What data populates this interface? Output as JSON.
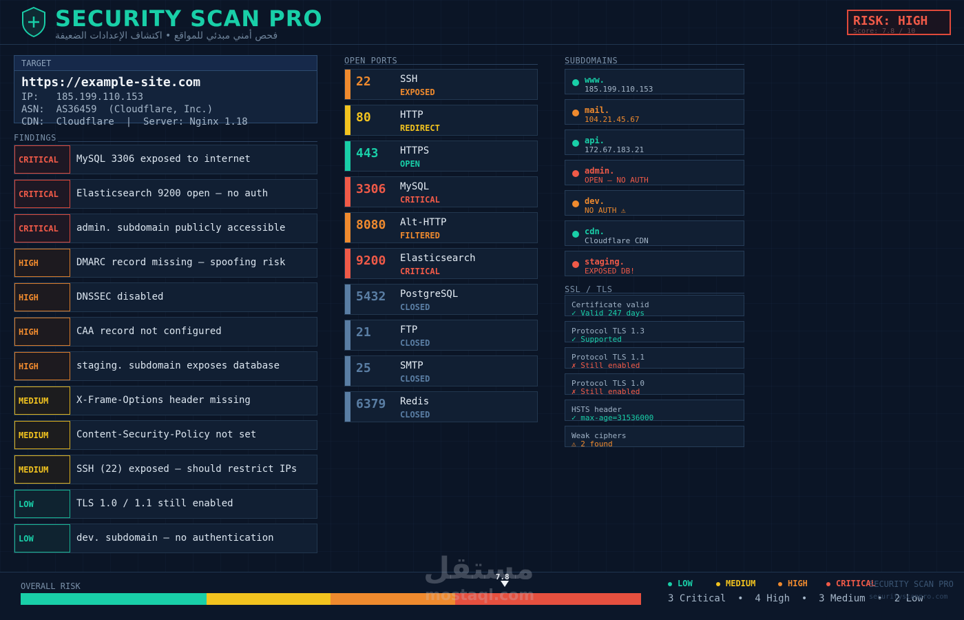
{
  "header": {
    "title": "SECURITY SCAN PRO",
    "subtitle": "فحص أمني مبدئي للمواقع  •  اكتشاف الإعدادات الضعيفة",
    "risk_label": "RISK: HIGH",
    "risk_score": "Score: 7.8 / 10"
  },
  "target": {
    "label": "TARGET",
    "url": "https://example-site.com",
    "ip": "IP:   185.199.110.153",
    "asn": "ASN:  AS36459  (Cloudflare, Inc.)",
    "cdn": "CDN:  Cloudflare  |  Server: Nginx 1.18"
  },
  "findings": {
    "label": "FINDINGS",
    "items": [
      {
        "severity": "CRITICAL",
        "level": "critical",
        "text": "MySQL 3306 exposed to internet"
      },
      {
        "severity": "CRITICAL",
        "level": "critical",
        "text": "Elasticsearch 9200 open — no auth"
      },
      {
        "severity": "CRITICAL",
        "level": "critical",
        "text": "admin. subdomain publicly accessible"
      },
      {
        "severity": "HIGH",
        "level": "high",
        "text": "DMARC record missing — spoofing risk"
      },
      {
        "severity": "HIGH",
        "level": "high",
        "text": "DNSSEC disabled"
      },
      {
        "severity": "HIGH",
        "level": "high",
        "text": "CAA record not configured"
      },
      {
        "severity": "HIGH",
        "level": "high",
        "text": "staging. subdomain exposes database"
      },
      {
        "severity": "MEDIUM",
        "level": "medium",
        "text": "X-Frame-Options header missing"
      },
      {
        "severity": "MEDIUM",
        "level": "medium",
        "text": "Content-Security-Policy not set"
      },
      {
        "severity": "MEDIUM",
        "level": "medium",
        "text": "SSH (22) exposed — should restrict IPs"
      },
      {
        "severity": "LOW",
        "level": "low",
        "text": "TLS 1.0 / 1.1 still enabled"
      },
      {
        "severity": "LOW",
        "level": "low",
        "text": "dev. subdomain — no authentication"
      }
    ]
  },
  "ports": {
    "label": "OPEN PORTS",
    "items": [
      {
        "port": "22",
        "service": "SSH",
        "status": "EXPOSED",
        "color": "#ef8a2e"
      },
      {
        "port": "80",
        "service": "HTTP",
        "status": "REDIRECT",
        "color": "#f2c31f"
      },
      {
        "port": "443",
        "service": "HTTPS",
        "status": "OPEN",
        "color": "#19cfa8"
      },
      {
        "port": "3306",
        "service": "MySQL",
        "status": "CRITICAL",
        "color": "#f05a48"
      },
      {
        "port": "8080",
        "service": "Alt-HTTP",
        "status": "FILTERED",
        "color": "#ef8a2e"
      },
      {
        "port": "9200",
        "service": "Elasticsearch",
        "status": "CRITICAL",
        "color": "#f05a48"
      },
      {
        "port": "5432",
        "service": "PostgreSQL",
        "status": "CLOSED",
        "color": "#5a7ea4"
      },
      {
        "port": "21",
        "service": "FTP",
        "status": "CLOSED",
        "color": "#5a7ea4"
      },
      {
        "port": "25",
        "service": "SMTP",
        "status": "CLOSED",
        "color": "#5a7ea4"
      },
      {
        "port": "6379",
        "service": "Redis",
        "status": "CLOSED",
        "color": "#5a7ea4"
      }
    ]
  },
  "subdomains": {
    "label": "SUBDOMAINS",
    "items": [
      {
        "name": "www.",
        "info": "185.199.110.153",
        "color": "#19cfa8",
        "info_color": "#a6b7c9"
      },
      {
        "name": "mail.",
        "info": "104.21.45.67",
        "color": "#ef8a2e",
        "info_color": "#ef8a2e"
      },
      {
        "name": "api.",
        "info": "172.67.183.21",
        "color": "#19cfa8",
        "info_color": "#a6b7c9"
      },
      {
        "name": "admin.",
        "info": "OPEN — NO AUTH",
        "color": "#f05a48",
        "info_color": "#f05a48"
      },
      {
        "name": "dev.",
        "info": "NO AUTH ⚠",
        "color": "#ef8a2e",
        "info_color": "#ef8a2e"
      },
      {
        "name": "cdn.",
        "info": "Cloudflare CDN",
        "color": "#19cfa8",
        "info_color": "#a6b7c9"
      },
      {
        "name": "staging.",
        "info": "EXPOSED DB!",
        "color": "#f05a48",
        "info_color": "#f05a48"
      }
    ]
  },
  "ssl": {
    "label": "SSL / TLS",
    "items": [
      {
        "name": "Certificate valid",
        "status": "✓ Valid 247 days",
        "color": "#19cfa8"
      },
      {
        "name": "Protocol TLS 1.3",
        "status": "✓ Supported",
        "color": "#19cfa8"
      },
      {
        "name": "Protocol TLS 1.1",
        "status": "✗ Still enabled",
        "color": "#f05a48"
      },
      {
        "name": "Protocol TLS 1.0",
        "status": "✗ Still enabled",
        "color": "#f05a48"
      },
      {
        "name": "HSTS header",
        "status": "✓ max-age=31536000",
        "color": "#19cfa8"
      },
      {
        "name": "Weak ciphers",
        "status": "⚠ 2 found",
        "color": "#ef8a2e"
      }
    ]
  },
  "footer": {
    "overall_label": "OVERALL RISK",
    "risk_value": "7.8",
    "risk_fraction": 0.78,
    "segments": [
      {
        "fraction": 0.3,
        "color": "#19cfa8"
      },
      {
        "fraction": 0.2,
        "color": "#f2c31f"
      },
      {
        "fraction": 0.2,
        "color": "#ef8a2e"
      },
      {
        "fraction": 0.3,
        "color": "#e6503f"
      }
    ],
    "legend": [
      {
        "label": "LOW",
        "color": "#19cfa8"
      },
      {
        "label": "MEDIUM",
        "color": "#f2c31f"
      },
      {
        "label": "HIGH",
        "color": "#ef8a2e"
      },
      {
        "label": "CRITICAL",
        "color": "#f05a48"
      }
    ],
    "counts": "3 Critical  •  4 High  •  3 Medium  •  2 Low",
    "brand": "SECURITY SCAN PRO",
    "brand_url": "securityscanpro.com"
  },
  "watermark": {
    "text": "مستقل",
    "url": "mostaql.com"
  }
}
